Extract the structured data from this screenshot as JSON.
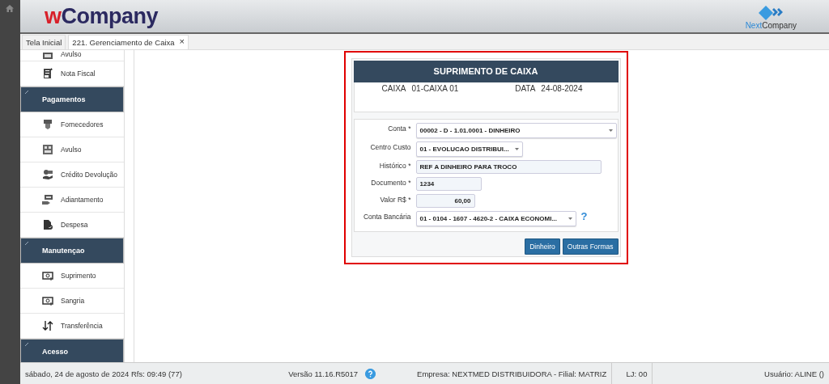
{
  "header": {
    "logo_prefix": "w",
    "logo_name": "Company",
    "partner_logo_prefix": "Next",
    "partner_logo_name": "Company"
  },
  "tabs": [
    {
      "label": "Tela Inicial",
      "selected": false
    },
    {
      "label": "221. Gerenciamento de Caixa",
      "selected": true,
      "close": "×"
    }
  ],
  "sidebar": {
    "items": [
      {
        "kind": "item",
        "label": "Avulso"
      },
      {
        "kind": "item",
        "label": "Nota Fiscal"
      },
      {
        "kind": "header",
        "label": "Pagamentos"
      },
      {
        "kind": "item",
        "label": "Fornecedores"
      },
      {
        "kind": "item",
        "label": "Avulso"
      },
      {
        "kind": "item",
        "label": "Crédito Devolução"
      },
      {
        "kind": "item",
        "label": "Adiantamento"
      },
      {
        "kind": "item",
        "label": "Despesa"
      },
      {
        "kind": "header",
        "label": "Manutençao"
      },
      {
        "kind": "item",
        "label": "Suprimento"
      },
      {
        "kind": "item",
        "label": "Sangria"
      },
      {
        "kind": "item",
        "label": "Transferência"
      },
      {
        "kind": "header",
        "label": "Acesso"
      }
    ]
  },
  "dialog": {
    "title": "SUPRIMENTO DE CAIXA",
    "info": [
      {
        "label": "CAIXA",
        "value": "01-CAIXA 01"
      },
      {
        "label": "DATA",
        "value": "24-08-2024"
      }
    ],
    "fields": [
      {
        "kind": "select",
        "label": "Conta *",
        "value": "00002 - D - 1.01.0001 - DINHEIRO"
      },
      {
        "kind": "select",
        "label": "Centro Custo",
        "value": "01 - EVOLUCAO DISTRIBUI..."
      },
      {
        "kind": "input",
        "label": "Histórico *",
        "value": "REF A DINHEIRO PARA TROCO"
      },
      {
        "kind": "input",
        "label": "Documento *",
        "value": "1234"
      },
      {
        "kind": "number",
        "label": "Valor R$ *",
        "value": "60,00"
      },
      {
        "kind": "select",
        "label": "Conta Bancária",
        "value": "01 - 0104 - 1607 - 4620-2 - CAIXA ECONOMI...",
        "help": "?"
      }
    ],
    "buttons": [
      "Dinheiro",
      "Outras Formas"
    ]
  },
  "status_bar": {
    "date": "sábado, 24 de agosto de 2024  Rfs: 09:49 (77)",
    "version": "Versão 11.16.R5017",
    "company": "Empresa: NEXTMED DISTRIBUIDORA - Filial: MATRIZ",
    "store": "LJ: 00",
    "user": "Usuário: ALINE ()"
  }
}
